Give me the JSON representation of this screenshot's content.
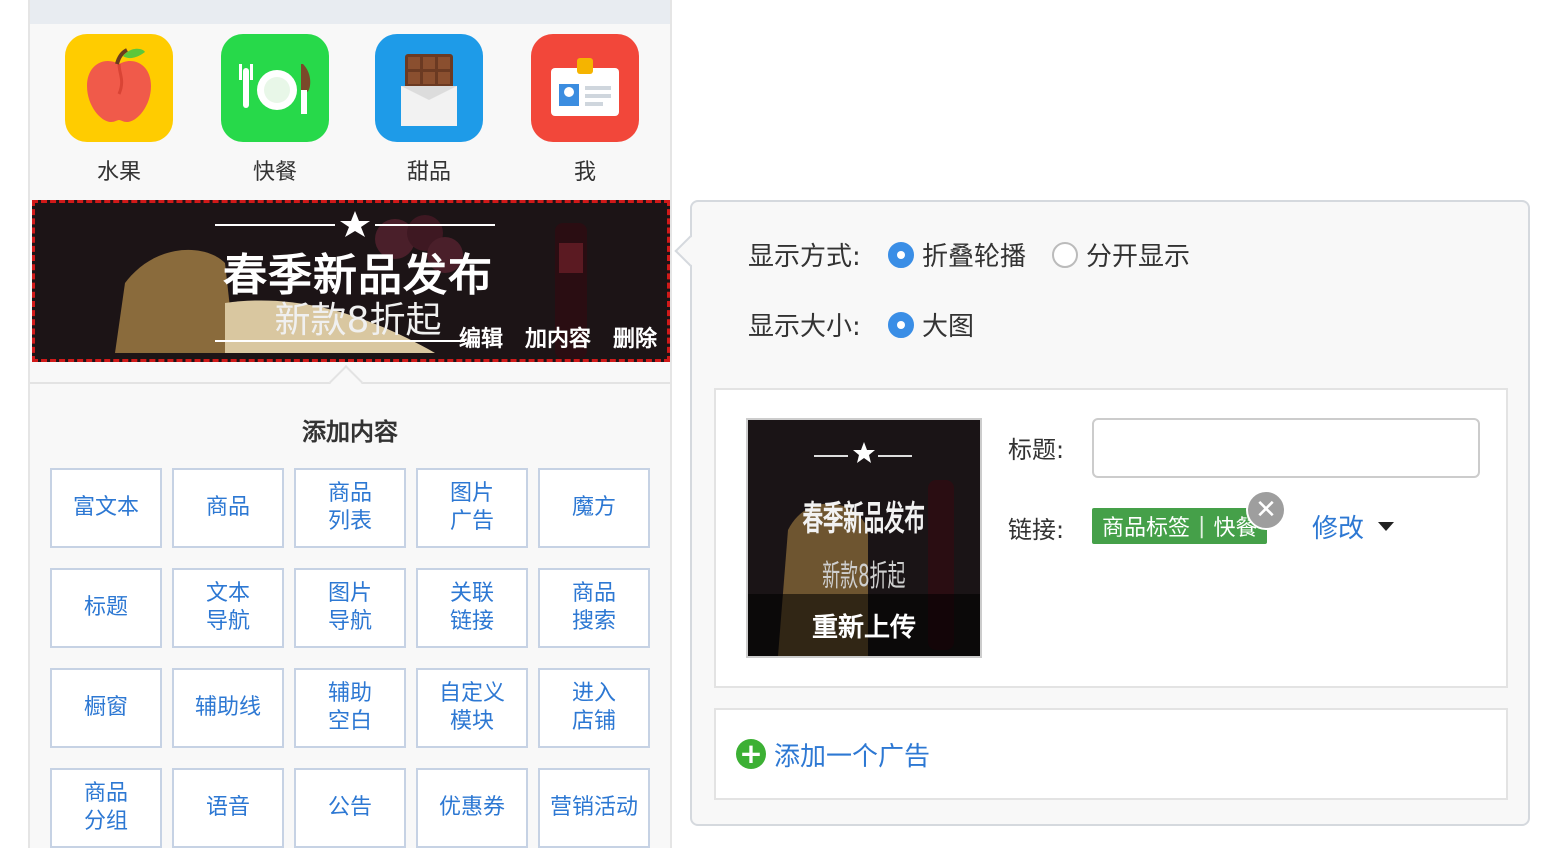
{
  "apps": [
    {
      "label": "水果",
      "icon": "apple-icon",
      "color": "#ffcc00"
    },
    {
      "label": "快餐",
      "icon": "plate-cutlery-icon",
      "color": "#27d94a"
    },
    {
      "label": "甜品",
      "icon": "chocolate-bar-icon",
      "color": "#1e9be8"
    },
    {
      "label": "我",
      "icon": "id-badge-icon",
      "color": "#f2473a"
    }
  ],
  "banner": {
    "headline": "春季新品发布",
    "subline": "新款8折起",
    "actions": {
      "edit": "编辑",
      "add": "加内容",
      "delete": "删除"
    },
    "border_color": "#d11919"
  },
  "add_content": {
    "title": "添加内容",
    "items": [
      "富文本",
      "商品",
      "商品\n列表",
      "图片\n广告",
      "魔方",
      "标题",
      "文本\n导航",
      "图片\n导航",
      "关联\n链接",
      "商品\n搜索",
      "橱窗",
      "辅助线",
      "辅助\n空白",
      "自定义\n模块",
      "进入\n店铺",
      "商品\n分组",
      "语音",
      "公告",
      "优惠券",
      "营销活动"
    ]
  },
  "settings": {
    "display_mode": {
      "label": "显示方式:",
      "options": [
        "折叠轮播",
        "分开显示"
      ],
      "selected": 0
    },
    "display_size": {
      "label": "显示大小:",
      "options": [
        "大图"
      ],
      "selected": 0
    },
    "ad": {
      "reupload": "重新上传",
      "title_label": "标题:",
      "title_value": "",
      "link_label": "链接:",
      "link_tag": {
        "type": "商品标签",
        "value": "快餐"
      },
      "modify": "修改"
    },
    "add_ad": "添加一个广告",
    "accent": "#3a8ee6",
    "link_color": "#2d78d3",
    "tag_color": "#45a049"
  }
}
